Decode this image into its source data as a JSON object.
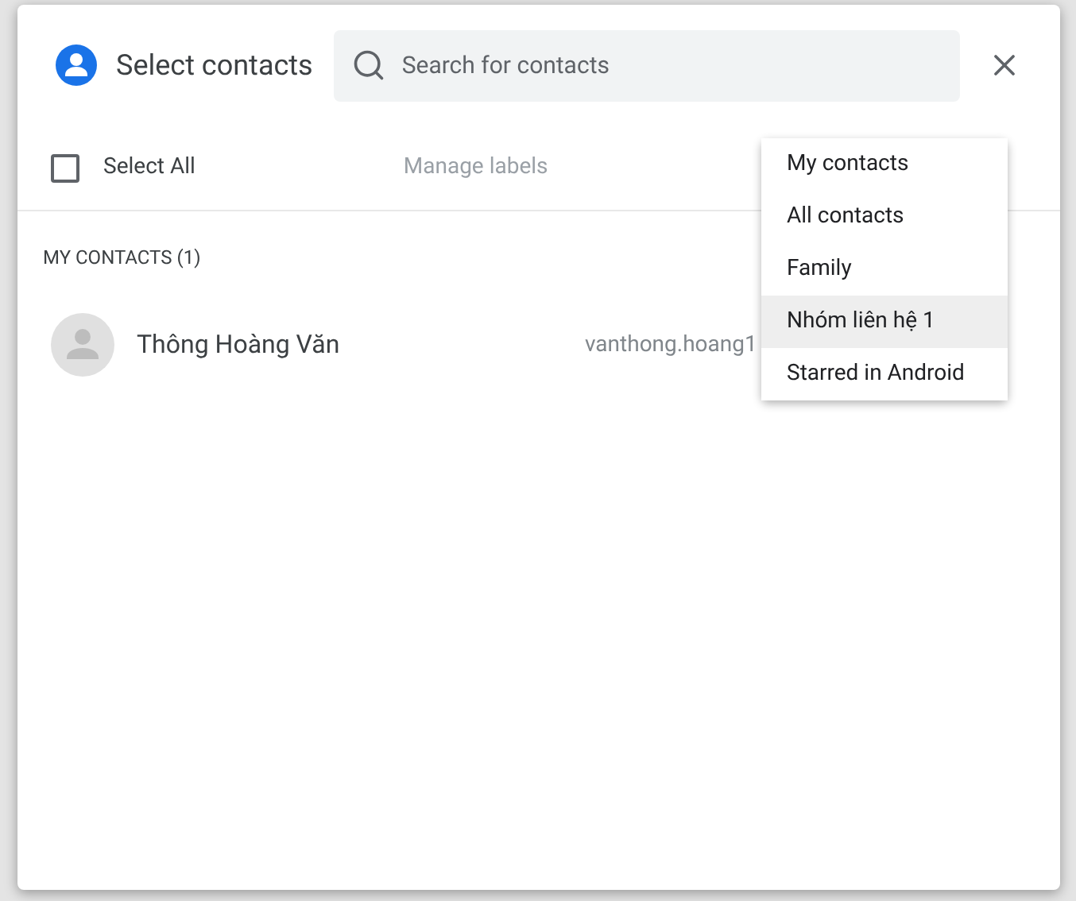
{
  "dialog": {
    "title": "Select contacts",
    "search": {
      "placeholder": "Search for contacts"
    },
    "select_all": {
      "label": "Select All",
      "checked": false
    },
    "manage_labels": "Manage labels",
    "section": "MY CONTACTS (1)",
    "contacts": [
      {
        "name": "Thông Hoàng Văn",
        "email": "vanthong.hoang1"
      }
    ]
  },
  "menu": {
    "items": [
      {
        "label": "My contacts",
        "selected": false
      },
      {
        "label": "All contacts",
        "selected": false
      },
      {
        "label": "Family",
        "selected": false
      },
      {
        "label": "Nhóm liên hệ 1",
        "selected": true
      },
      {
        "label": "Starred in Android",
        "selected": false
      }
    ]
  }
}
